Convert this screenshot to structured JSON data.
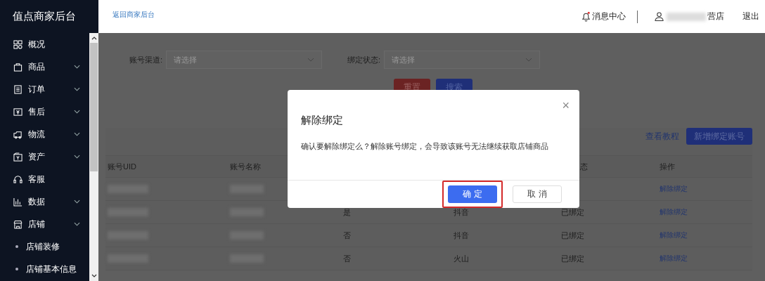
{
  "sidebar": {
    "title": "值点商家后台",
    "items": [
      {
        "label": "概况",
        "expandable": false
      },
      {
        "label": "商品",
        "expandable": true
      },
      {
        "label": "订单",
        "expandable": true
      },
      {
        "label": "售后",
        "expandable": true
      },
      {
        "label": "物流",
        "expandable": true
      },
      {
        "label": "资产",
        "expandable": true
      },
      {
        "label": "客服",
        "expandable": false
      },
      {
        "label": "数据",
        "expandable": true
      },
      {
        "label": "店铺",
        "expandable": true,
        "children": [
          {
            "label": "店铺装修"
          },
          {
            "label": "店铺基本信息"
          }
        ]
      }
    ]
  },
  "header": {
    "back_link": "返回商家后台",
    "messages": "消息中心",
    "user_suffix": "营店",
    "logout": "退出"
  },
  "filters": [
    {
      "label": "账号渠道:",
      "placeholder": "请选择"
    },
    {
      "label": "绑定状态:",
      "placeholder": "请选择"
    }
  ],
  "filter_buttons": [
    {
      "label": "重置",
      "kind": "reset"
    },
    {
      "label": "搜索",
      "kind": "search"
    }
  ],
  "toolbar": {
    "tutorial_link": "查看教程",
    "add_button": "新增绑定账号"
  },
  "table": {
    "columns": [
      "账号UID",
      "账号名称",
      null,
      null,
      "态",
      "操作"
    ],
    "rows": [
      {
        "cells": [
          {
            "kind": "blurred"
          },
          {
            "kind": "blurred"
          },
          null,
          null,
          null,
          {
            "kind": "link",
            "text": "解除绑定"
          }
        ]
      },
      {
        "cells": [
          {
            "kind": "blurred"
          },
          {
            "kind": "blurred"
          },
          {
            "kind": "text",
            "text": "是"
          },
          {
            "kind": "text",
            "text": "抖音"
          },
          {
            "kind": "text",
            "text": "已绑定"
          },
          {
            "kind": "link",
            "text": "解除绑定"
          }
        ]
      },
      {
        "cells": [
          {
            "kind": "blurred"
          },
          {
            "kind": "blurred"
          },
          {
            "kind": "text",
            "text": "否"
          },
          {
            "kind": "text",
            "text": "抖音"
          },
          {
            "kind": "text",
            "text": "已绑定"
          },
          {
            "kind": "link",
            "text": "解除绑定"
          }
        ]
      },
      {
        "cells": [
          {
            "kind": "blurred"
          },
          {
            "kind": "blurred"
          },
          {
            "kind": "text",
            "text": "否"
          },
          {
            "kind": "text",
            "text": "火山"
          },
          {
            "kind": "text",
            "text": "已绑定"
          },
          {
            "kind": "link",
            "text": "解除绑定"
          }
        ]
      }
    ]
  },
  "dialog": {
    "title": "解除绑定",
    "close": "×",
    "message": "确认要解除绑定么？解除账号绑定，会导致该账号无法继续获取店铺商品",
    "buttons": [
      {
        "label": "确 定",
        "kind": "primary",
        "highlighted": true
      },
      {
        "label": "取 消",
        "kind": "default",
        "highlighted": false
      }
    ]
  }
}
